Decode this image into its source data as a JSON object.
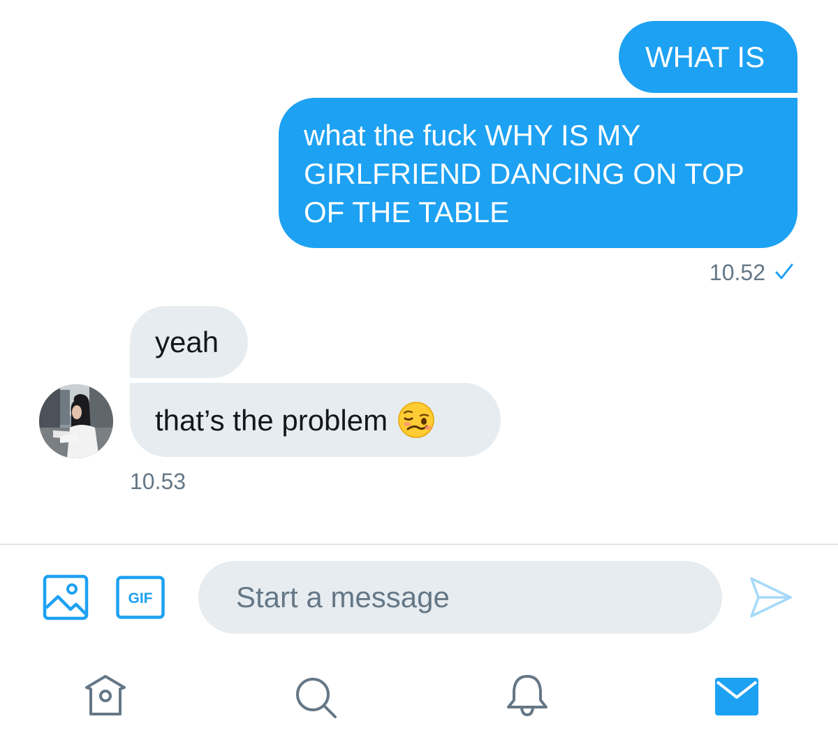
{
  "conversation": {
    "sent_messages": [
      {
        "text": "WHAT IS"
      },
      {
        "lines": [
          "what the fuck WHY IS MY",
          "GIRLFRIEND DANCING ON TOP",
          "OF THE TABLE"
        ]
      }
    ],
    "sent_timestamp": "10.52",
    "received_messages": [
      {
        "text": "yeah"
      },
      {
        "text": "that’s the problem",
        "emoji": "woozy-face"
      }
    ],
    "received_timestamp": "10.53"
  },
  "composer": {
    "placeholder": "Start a message",
    "value": ""
  },
  "toolbar": {
    "gif_label": "GIF",
    "media_icon": "image-icon",
    "send_icon": "send-icon"
  },
  "tab_bar": {
    "tabs": [
      {
        "name": "home",
        "icon": "home-icon",
        "active": false
      },
      {
        "name": "search",
        "icon": "search-icon",
        "active": false
      },
      {
        "name": "notifications",
        "icon": "bell-icon",
        "active": false
      },
      {
        "name": "messages",
        "icon": "envelope-icon",
        "active": true
      }
    ]
  },
  "colors": {
    "accent": "#1da1f2",
    "received_bubble": "#e6ecf0",
    "secondary_text": "#657786",
    "inactive_icon": "#657786"
  }
}
